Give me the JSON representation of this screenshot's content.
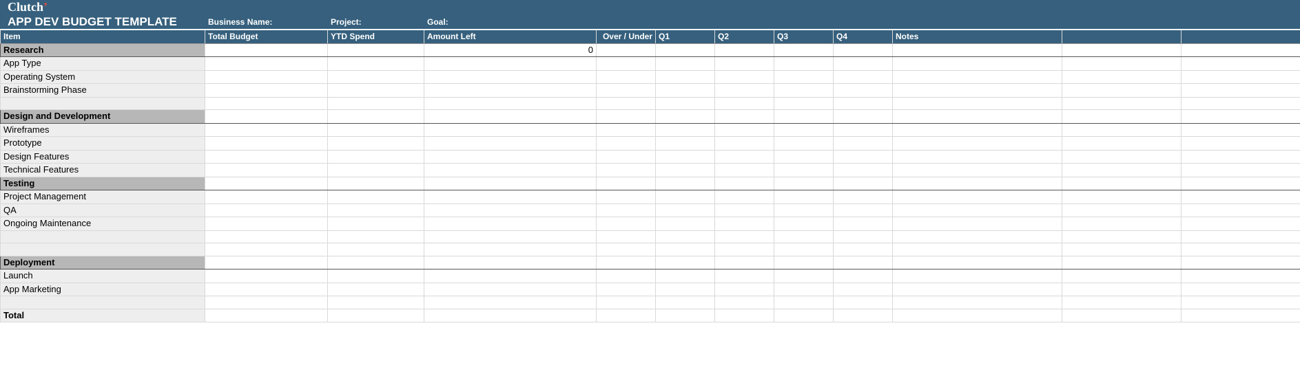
{
  "brand_html": "Clutch",
  "title": "APP DEV BUDGET TEMPLATE",
  "fields": {
    "business_name_label": "Business Name:",
    "project_label": "Project:",
    "goal_label": "Goal:"
  },
  "columns": {
    "item": "Item",
    "total_budget": "Total Budget",
    "ytd_spend": "YTD Spend",
    "amount_left": "Amount Left",
    "over_under": "Over / Under",
    "q1": "Q1",
    "q2": "Q2",
    "q3": "Q3",
    "q4": "Q4",
    "notes": "Notes"
  },
  "sections": [
    {
      "name": "Research",
      "amount_left": "0",
      "items": [
        "App Type",
        "Operating System",
        "Brainstorming Phase"
      ],
      "trailing_blank_rows": 1
    },
    {
      "name": "Design and Development",
      "amount_left": "",
      "items": [
        "Wireframes",
        "Prototype",
        "Design Features",
        "Technical Features"
      ],
      "trailing_blank_rows": 0
    },
    {
      "name": "Testing",
      "amount_left": "",
      "items": [
        "Project Management",
        "QA",
        "Ongoing Maintenance"
      ],
      "trailing_blank_rows": 2
    },
    {
      "name": "Deployment",
      "amount_left": "",
      "items": [
        "Launch",
        "App Marketing"
      ],
      "trailing_blank_rows": 1
    }
  ],
  "total_label": "Total"
}
